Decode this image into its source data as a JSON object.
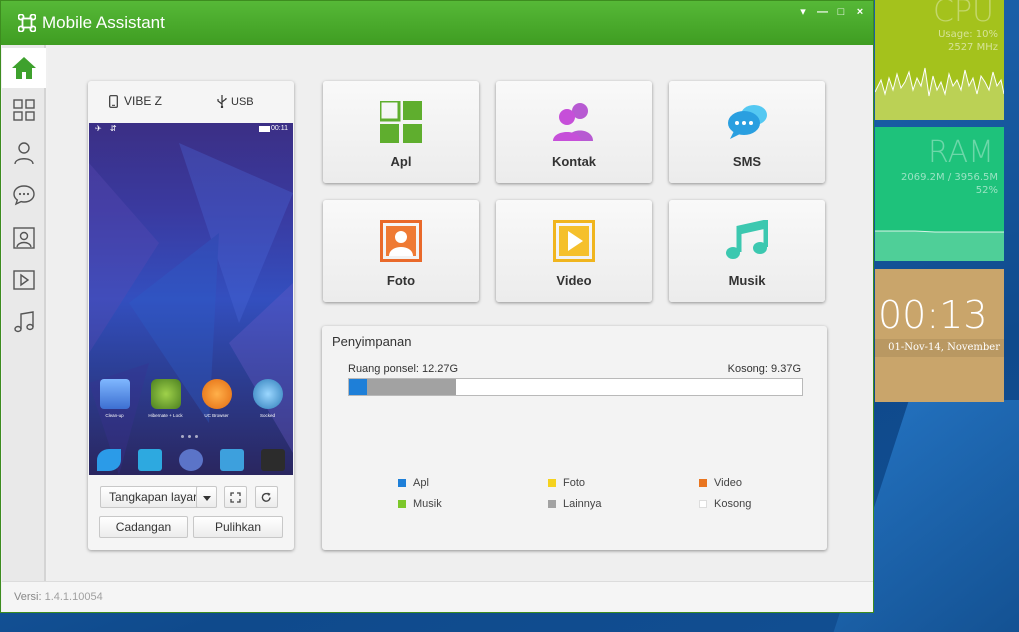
{
  "window": {
    "title": "Mobile Assistant",
    "controls": [
      "▾",
      "—",
      "□",
      "×"
    ]
  },
  "sidebar": {
    "items": [
      {
        "name": "home",
        "active": true
      },
      {
        "name": "apps"
      },
      {
        "name": "contacts"
      },
      {
        "name": "messages"
      },
      {
        "name": "photos"
      },
      {
        "name": "video"
      },
      {
        "name": "music"
      }
    ]
  },
  "phone": {
    "device_name": "VIBE Z",
    "connection": "USB",
    "screen_time": "00:11",
    "home_apps": [
      "Clean-up",
      "Hibernate + Lock",
      "UC Browser",
      "Socked"
    ],
    "screenshot_label": "Tangkapan layar",
    "backup_label": "Cadangan",
    "restore_label": "Pulihkan"
  },
  "tiles": {
    "apps": "Apl",
    "contacts": "Kontak",
    "sms": "SMS",
    "photos": "Foto",
    "video": "Video",
    "music": "Musik"
  },
  "storage": {
    "title": "Penyimpanan",
    "phone_space": "Ruang ponsel: 12.27G",
    "free_space": "Kosong: 9.37G",
    "segments": [
      {
        "name": "Apl",
        "fraction": 0.04,
        "color": "#1e7fd8"
      },
      {
        "name": "Lainnya",
        "fraction": 0.197,
        "color": "#a2a2a2"
      },
      {
        "name": "Kosong",
        "fraction": 0.763,
        "color": "#ffffff"
      }
    ],
    "legend": [
      {
        "label": "Apl",
        "color": "#1e7fd8"
      },
      {
        "label": "Foto",
        "color": "#f5d21e"
      },
      {
        "label": "Video",
        "color": "#e9751f"
      },
      {
        "label": "Musik",
        "color": "#7cc72a"
      },
      {
        "label": "Lainnya",
        "color": "#a2a2a2"
      },
      {
        "label": "Kosong",
        "color": "#ffffff"
      }
    ]
  },
  "status": {
    "version_label": "Versi:",
    "version": "1.4.1.10054"
  },
  "widgets": {
    "cpu_title": "CPU",
    "cpu_usage": "Usage: 10%",
    "cpu_freq": "2527 MHz",
    "ram_title": "RAM",
    "ram_used": "2069.2M / 3956.5M",
    "ram_pct": "52%",
    "clock_time": "00:13",
    "clock_date": "01-Nov-14, November"
  },
  "colors": {
    "brand_green": "#4aa82b",
    "accent_blue": "#1e7fd8"
  }
}
